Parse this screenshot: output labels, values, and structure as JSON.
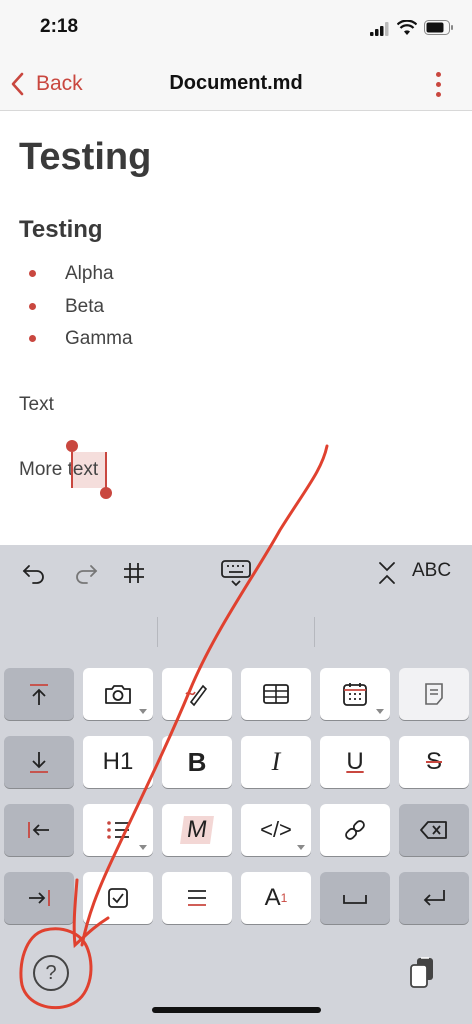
{
  "status_bar": {
    "time": "2:18"
  },
  "nav": {
    "back_label": "Back",
    "title": "Document.md"
  },
  "document": {
    "heading1": "Testing",
    "heading2": "Testing",
    "list_items": [
      "Alpha",
      "Beta",
      "Gamma"
    ],
    "paragraph1": "Text",
    "paragraph2_prefix": "More ",
    "paragraph2_selected": "text"
  },
  "toolbar": {
    "abc_label": "ABC"
  },
  "keys": {
    "h1": "H1",
    "bold": "B",
    "italic": "I",
    "underline": "U",
    "strike": "S",
    "mark": "M",
    "code": "</>",
    "font_size": "A",
    "font_size_sup": "1"
  },
  "colors": {
    "accent": "#c9473f",
    "keyboard_bg": "#d2d4da",
    "nav_bg": "#f7f7f7"
  }
}
